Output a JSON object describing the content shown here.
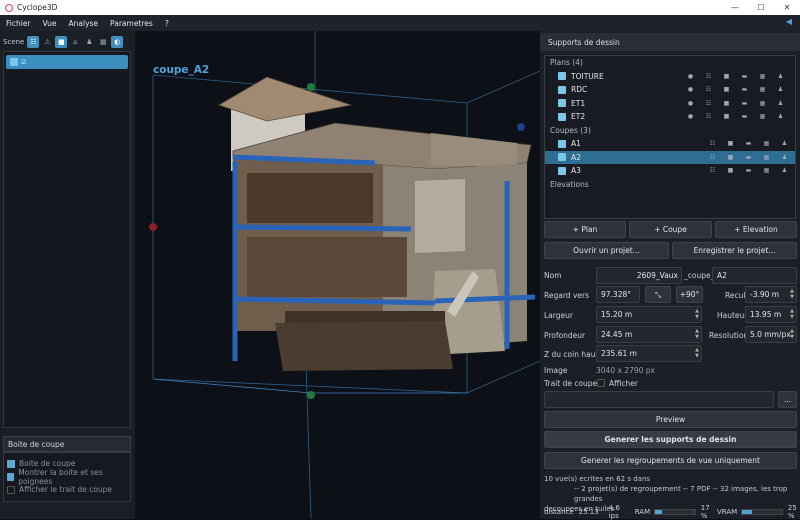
{
  "titlebar": {
    "title": "Cyclope3D"
  },
  "menu": [
    "Fichier",
    "Vue",
    "Analyse",
    "Parametres",
    "?"
  ],
  "scene": {
    "label": "Scene",
    "item_label": "☑"
  },
  "boite": {
    "header": "Boite de coupe",
    "items": [
      "Boite de coupe",
      "Montrer la boite et ses poignees",
      "Afficher le trait de coupe"
    ]
  },
  "viewport": {
    "section_label": "coupe_A2"
  },
  "supports": {
    "header": "Supports de dessin",
    "plans_group": "Plans (4)",
    "plans": [
      "TOITURE",
      "RDC",
      "ET1",
      "ET2"
    ],
    "coupes_group": "Coupes (3)",
    "coupes": [
      "A1",
      "A2",
      "A3"
    ],
    "elevations_group": "Elevations",
    "selected": "A2"
  },
  "buttons": {
    "add_plan": "+ Plan",
    "add_coupe": "+ Coupe",
    "add_elevation": "+ Elevation",
    "open_project": "Ouvrir un projet...",
    "save_project": "Enregistrer le projet...",
    "preview": "Preview",
    "generate": "Generer les supports de dessin",
    "generate_views": "Generer les regroupements de vue uniquement",
    "plus90": "+90°",
    "browse": "..."
  },
  "form": {
    "nom_label": "Nom",
    "nom_prefix": "2609_Vaux",
    "nom_mid": "_coupe_",
    "nom_value": "A2",
    "regard_label": "Regard vers",
    "regard_value": "97.328°",
    "recul_label": "Recul",
    "recul_value": "-3.90 m",
    "largeur_label": "Largeur",
    "largeur_value": "15.20 m",
    "hauteur_label": "Hauteur",
    "hauteur_value": "13.95 m",
    "profondeur_label": "Profondeur",
    "profondeur_value": "24.45 m",
    "resolution_label": "Resolution",
    "resolution_value": "5.0 mm/px",
    "z_label": "Z du coin haut",
    "z_value": "235.61 m",
    "image_label": "Image",
    "image_value": "3040 x 2790 px",
    "trait_label": "Trait de coupe",
    "afficher_label": "Afficher"
  },
  "log": [
    "10 vue(s) ecrites en 62 s dans",
    "-- 2 projet(s) de regroupement -- 7 PDF -- 32 images, les trop grandes",
    "decoupees en tuiles"
  ],
  "status": {
    "distance_label": "distance",
    "distance_value": "25.13",
    "fps": "4.6 ips",
    "ram_label": "RAM",
    "ram_pct": "17 %",
    "vram_label": "VRAM",
    "vram_pct": "25 %",
    "ram_fill": 0.17,
    "vram_fill": 0.25
  },
  "colors": {
    "accent": "#3b8fbf",
    "selection": "#2f6e93",
    "box": "#2a64b8"
  }
}
